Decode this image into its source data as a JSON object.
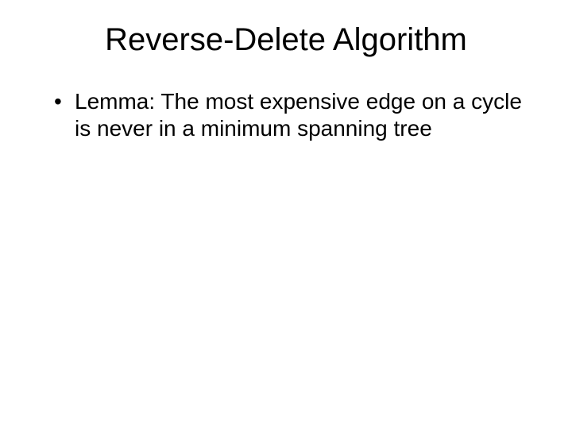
{
  "title": "Reverse-Delete Algorithm",
  "bullets": {
    "item0": "Lemma:  The most expensive edge on a cycle is never in a minimum spanning tree"
  }
}
